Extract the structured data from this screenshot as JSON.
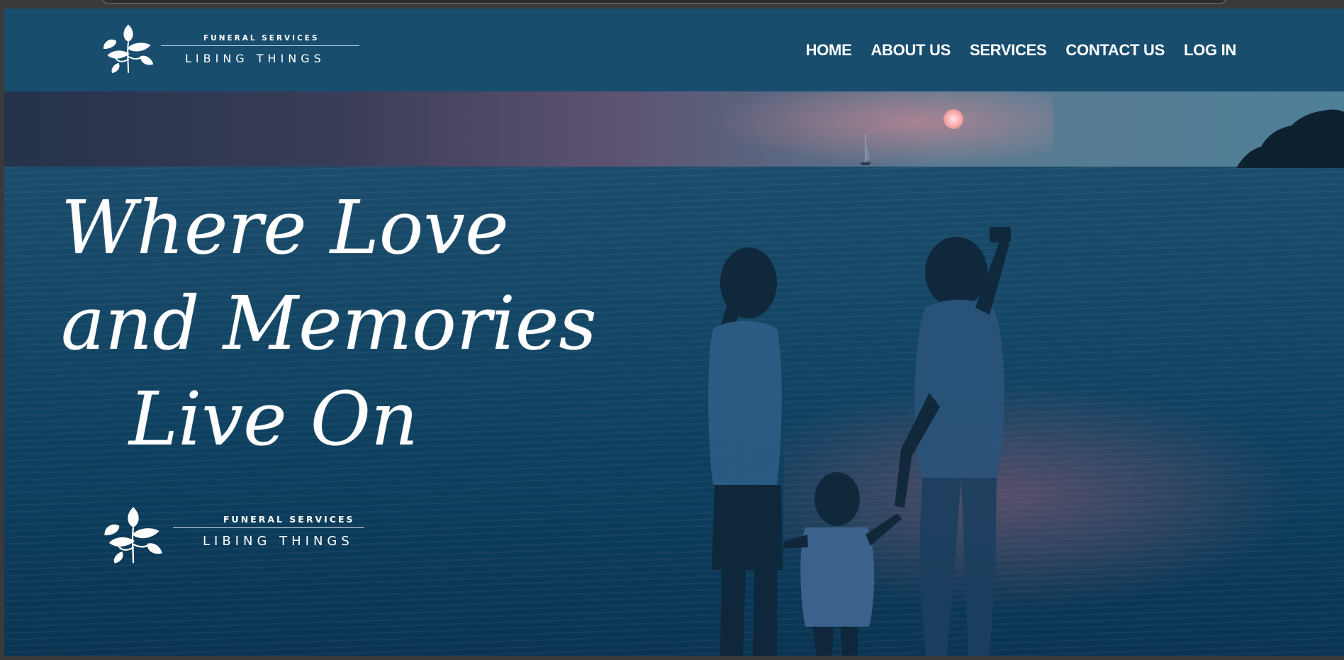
{
  "header": {
    "logo": {
      "top_text": "FUNERAL SERVICES",
      "bottom_text": "LIBING THINGS"
    },
    "nav": [
      {
        "label": "HOME"
      },
      {
        "label": "ABOUT US"
      },
      {
        "label": "SERVICES"
      },
      {
        "label": "CONTACT US"
      },
      {
        "label": "LOG IN"
      }
    ]
  },
  "hero": {
    "tagline": [
      "Where Love",
      "and Memories",
      "Live On"
    ],
    "logo": {
      "top_text": "FUNERAL SERVICES",
      "bottom_text": "LIBING THINGS"
    }
  },
  "colors": {
    "header_bg": "#184d6e",
    "nav_text": "#ffffff",
    "sea_dark": "#0d3d5c"
  }
}
